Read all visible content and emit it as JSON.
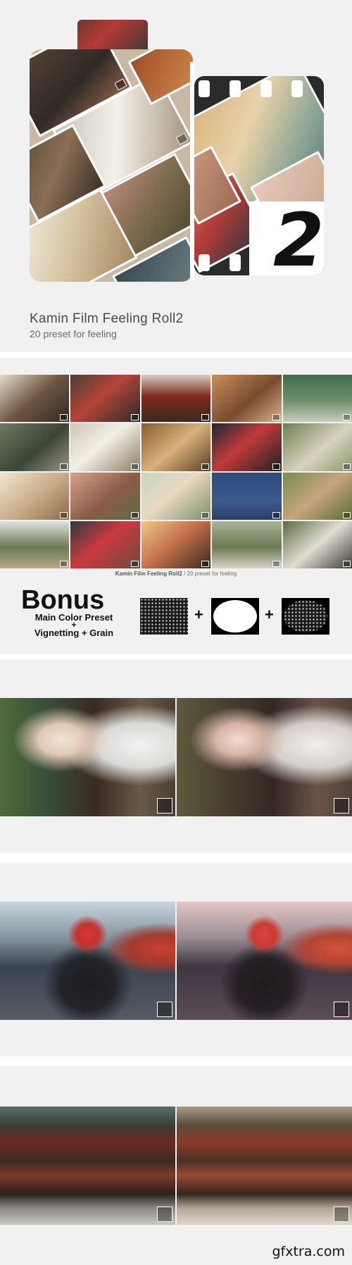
{
  "hero": {
    "title": "Kamin Film Feeling Roll2",
    "subtitle": "20 preset for feeling",
    "roll_number": "2"
  },
  "grid": {
    "caption_title": "Kamin Film Feeling Roll2",
    "caption_sep": " / ",
    "caption_sub": "20 preset for feeling"
  },
  "bonus": {
    "title": "Bonus",
    "line1": "Main Color Preset",
    "plus_small": "+",
    "line2": "Vignetting + Grain",
    "plus": "+"
  },
  "watermark": "gfxtra.com"
}
